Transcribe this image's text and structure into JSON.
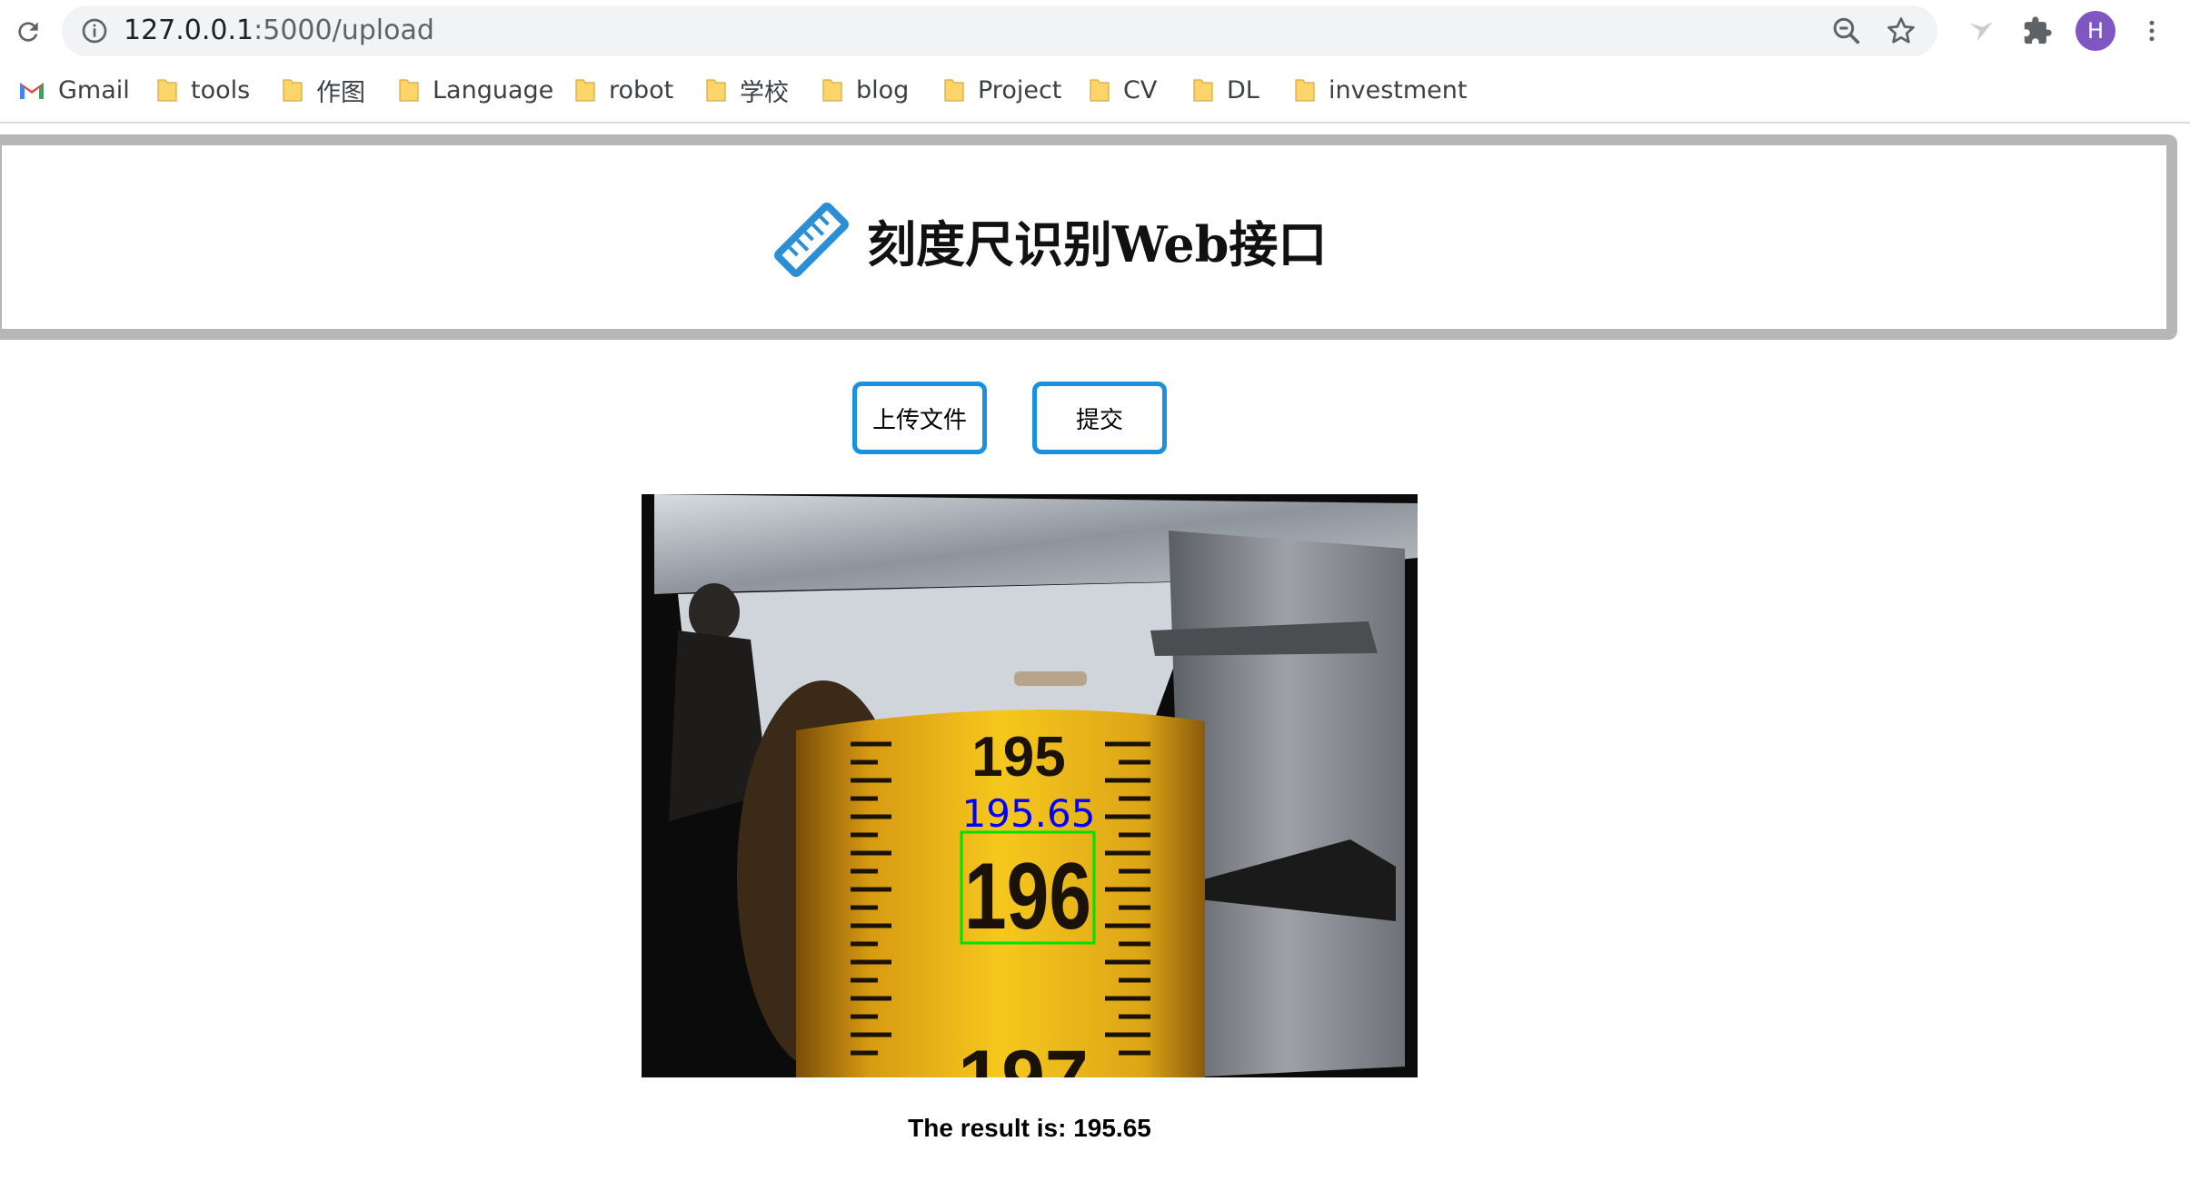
{
  "browser": {
    "url_host": "127.0.0.1",
    "url_path": ":5000/upload",
    "profile_initial": "H"
  },
  "bookmarks": [
    {
      "label": "Gmail",
      "icon": "gmail-icon"
    },
    {
      "label": "tools",
      "icon": "folder-icon"
    },
    {
      "label": "作图",
      "icon": "folder-icon"
    },
    {
      "label": "Language",
      "icon": "folder-icon"
    },
    {
      "label": "robot",
      "icon": "folder-icon"
    },
    {
      "label": "学校",
      "icon": "folder-icon"
    },
    {
      "label": "blog",
      "icon": "folder-icon"
    },
    {
      "label": "Project",
      "icon": "folder-icon"
    },
    {
      "label": "CV",
      "icon": "folder-icon"
    },
    {
      "label": "DL",
      "icon": "folder-icon"
    },
    {
      "label": "investment",
      "icon": "folder-icon"
    }
  ],
  "page": {
    "title": "刻度尺识别Web接口",
    "upload_button": "上传文件",
    "submit_button": "提交",
    "result_text": "The result is: 195.65"
  },
  "image": {
    "detected_value": "195.65",
    "scale_labels": [
      "195",
      "196",
      "197"
    ],
    "box_color": "#00e000",
    "text_color": "#0000ff"
  },
  "colors": {
    "accent": "#1a90e0",
    "header_border": "#b6b6b6",
    "tape": "#f2c21a"
  }
}
